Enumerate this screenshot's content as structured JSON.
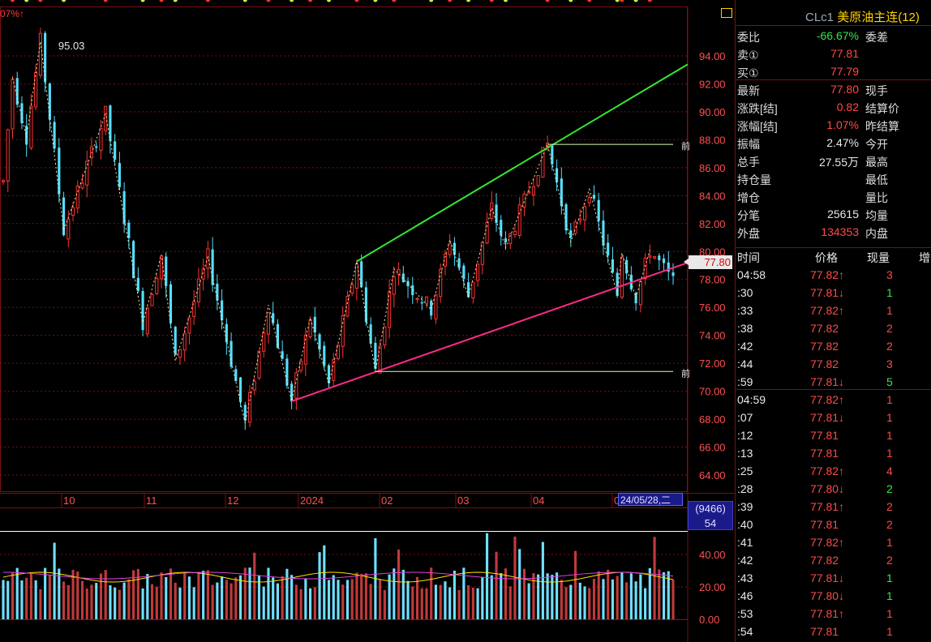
{
  "header": {
    "top_percent": "07%↑",
    "instrument_code": "CLc1",
    "instrument_name": "美原油主连",
    "instrument_count": "(12)"
  },
  "quote": [
    {
      "label": "委比",
      "value": "-66.67%",
      "value_color": "green",
      "label2": "委差"
    },
    {
      "label": "卖①",
      "value": "77.81",
      "value_color": "red",
      "label2": ""
    },
    {
      "label": "买①",
      "value": "77.79",
      "value_color": "red",
      "label2": ""
    },
    {
      "label": "最新",
      "value": "77.80",
      "value_color": "red",
      "label2": "现手"
    },
    {
      "label": "涨跌[结]",
      "value": "0.82",
      "value_color": "red",
      "label2": "结算价"
    },
    {
      "label": "涨幅[结]",
      "value": "1.07%",
      "value_color": "red",
      "label2": "昨结算"
    },
    {
      "label": "振幅",
      "value": "2.47%",
      "value_color": "white",
      "label2": "今开"
    },
    {
      "label": "总手",
      "value": "27.55万",
      "value_color": "white",
      "label2": "最高"
    },
    {
      "label": "持仓量",
      "value": "",
      "value_color": "white",
      "label2": "最低"
    },
    {
      "label": "增仓",
      "value": "",
      "value_color": "white",
      "label2": "量比"
    },
    {
      "label": "分笔",
      "value": "25615",
      "value_color": "white",
      "label2": "均量"
    },
    {
      "label": "外盘",
      "value": "134353",
      "value_color": "red",
      "label2": "内盘"
    }
  ],
  "ticks_header": {
    "time": "时间",
    "price": "价格",
    "volume": "现量",
    "extra": "增"
  },
  "ticks": [
    {
      "time": "04:58",
      "price": "77.82↑",
      "vol": "3",
      "price_color": "red",
      "vol_color": "red"
    },
    {
      "time": ":30",
      "price": "77.81↓",
      "vol": "1",
      "price_color": "red",
      "vol_color": "green"
    },
    {
      "time": ":33",
      "price": "77.82↑",
      "vol": "1",
      "price_color": "red",
      "vol_color": "red"
    },
    {
      "time": ":38",
      "price": "77.82",
      "vol": "2",
      "price_color": "red",
      "vol_color": "red"
    },
    {
      "time": ":42",
      "price": "77.82",
      "vol": "2",
      "price_color": "red",
      "vol_color": "red"
    },
    {
      "time": ":44",
      "price": "77.82",
      "vol": "3",
      "price_color": "red",
      "vol_color": "red"
    },
    {
      "time": ":59",
      "price": "77.81↓",
      "vol": "5",
      "price_color": "red",
      "vol_color": "green"
    },
    {
      "time": "04:59",
      "price": "77.82↑",
      "vol": "1",
      "price_color": "red",
      "vol_color": "red"
    },
    {
      "time": ":07",
      "price": "77.81↓",
      "vol": "1",
      "price_color": "red",
      "vol_color": "red"
    },
    {
      "time": ":12",
      "price": "77.81",
      "vol": "1",
      "price_color": "red",
      "vol_color": "red"
    },
    {
      "time": ":13",
      "price": "77.81",
      "vol": "1",
      "price_color": "red",
      "vol_color": "red"
    },
    {
      "time": ":25",
      "price": "77.82↑",
      "vol": "4",
      "price_color": "red",
      "vol_color": "red"
    },
    {
      "time": ":28",
      "price": "77.80↓",
      "vol": "2",
      "price_color": "red",
      "vol_color": "green"
    },
    {
      "time": ":39",
      "price": "77.81↑",
      "vol": "2",
      "price_color": "red",
      "vol_color": "red"
    },
    {
      "time": ":40",
      "price": "77.81",
      "vol": "2",
      "price_color": "red",
      "vol_color": "red"
    },
    {
      "time": ":41",
      "price": "77.82↑",
      "vol": "1",
      "price_color": "red",
      "vol_color": "red"
    },
    {
      "time": ":42",
      "price": "77.82",
      "vol": "2",
      "price_color": "red",
      "vol_color": "red"
    },
    {
      "time": ":43",
      "price": "77.81↓",
      "vol": "1",
      "price_color": "red",
      "vol_color": "green"
    },
    {
      "time": ":46",
      "price": "77.80↓",
      "vol": "1",
      "price_color": "red",
      "vol_color": "green"
    },
    {
      "time": ":53",
      "price": "77.81↑",
      "vol": "1",
      "price_color": "red",
      "vol_color": "red"
    },
    {
      "time": ":54",
      "price": "77.81",
      "vol": "1",
      "price_color": "red",
      "vol_color": "red"
    }
  ],
  "chart_overlays": {
    "current_price_tag": "77.80",
    "cursor_date": "24/05/28,二",
    "volume_box_line1": "(9466)",
    "volume_box_line2": "54",
    "max_label": "95.03",
    "side_marker_top": "前",
    "side_marker_bottom": "前"
  },
  "colors": {
    "up": "#ff3333",
    "down": "#55e0ff",
    "grid": "#7a1010",
    "trend_upper": "#33e833",
    "trend_lower": "#ff2a8a",
    "pivot_high": "#ff3a3a",
    "pivot_low": "#33ff33"
  },
  "chart_data": {
    "type": "candlestick",
    "y_ticks": [
      94.0,
      92.0,
      90.0,
      88.0,
      86.0,
      84.0,
      82.0,
      80.0,
      78.0,
      76.0,
      74.0,
      72.0,
      70.0,
      68.0,
      66.0,
      64.0
    ],
    "x_ticks": [
      "10",
      "11",
      "12",
      "2024",
      "02",
      "03",
      "04",
      "0"
    ],
    "ylim": [
      62.5,
      96.5
    ],
    "volume_ticks": [
      40.0,
      20.0,
      0.0
    ],
    "pivots_high": [
      {
        "label": "92.43",
        "x": 2,
        "value": 92.43
      },
      {
        "label": "95.03",
        "x": 8,
        "value": 95.03
      },
      {
        "label": "89.85",
        "x": 22,
        "value": 89.85
      },
      {
        "label": "79.77",
        "x": 34,
        "value": 79.77
      },
      {
        "label": "79.60",
        "x": 44,
        "value": 79.6
      },
      {
        "label": "76.18",
        "x": 57,
        "value": 76.18
      },
      {
        "label": "75.25",
        "x": 66,
        "value": 75.25
      },
      {
        "label": "79.29",
        "x": 76,
        "value": 79.29
      },
      {
        "label": "78.77",
        "x": 84,
        "value": 78.77
      },
      {
        "label": "80.85",
        "x": 96,
        "value": 80.85
      },
      {
        "label": "83.12",
        "x": 105,
        "value": 83.12
      },
      {
        "label": "87.67",
        "x": 117,
        "value": 87.67
      },
      {
        "label": "84.46",
        "x": 126,
        "value": 84.46
      },
      {
        "label": "79.9",
        "x": 133,
        "value": 79.9
      },
      {
        "label": "80.11",
        "x": 139,
        "value": 80.11
      }
    ],
    "pivots_low": [
      {
        "label": "88.19",
        "x": 5,
        "value": 88.19
      },
      {
        "label": "81.50",
        "x": 13,
        "value": 81.5
      },
      {
        "label": "74.91",
        "x": 30,
        "value": 74.91
      },
      {
        "label": "72.16",
        "x": 37,
        "value": 72.16
      },
      {
        "label": "67.71",
        "x": 52,
        "value": 67.71
      },
      {
        "label": "69.28",
        "x": 62,
        "value": 69.28
      },
      {
        "label": "70.50",
        "x": 70,
        "value": 70.5
      },
      {
        "label": "71.41",
        "x": 80,
        "value": 71.41
      },
      {
        "label": "75.84",
        "x": 92,
        "value": 75.84
      },
      {
        "label": "76.79",
        "x": 100,
        "value": 76.79
      },
      {
        "label": "80.30",
        "x": 108,
        "value": 80.3
      },
      {
        "label": "80.70",
        "x": 122,
        "value": 80.7
      },
      {
        "label": "76.89",
        "x": 132,
        "value": 76.89
      },
      {
        "label": "76.70",
        "x": 136,
        "value": 76.7
      }
    ]
  }
}
